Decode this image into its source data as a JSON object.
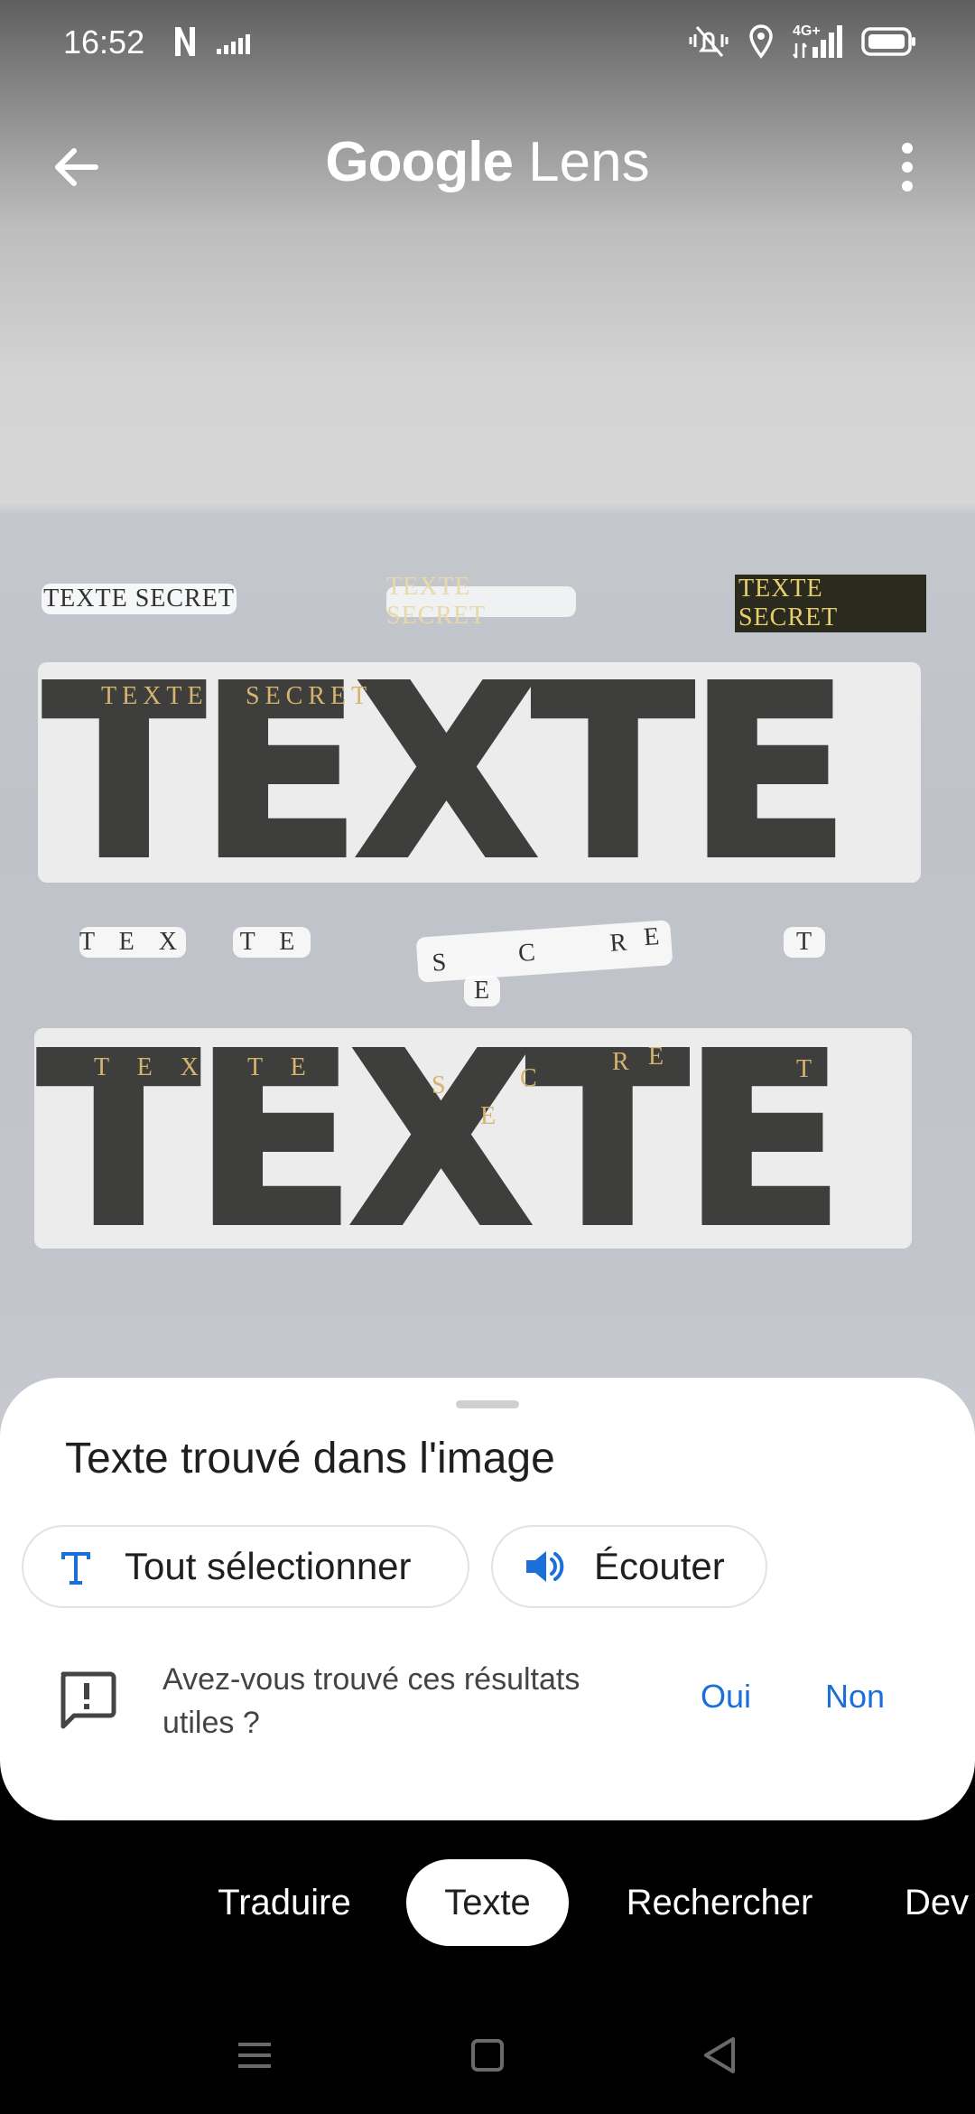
{
  "status_bar": {
    "time": "16:52",
    "icons_left": [
      "netflix-icon",
      "signal-bars-icon"
    ],
    "icons_right": [
      "vibrate-off-icon",
      "location-icon",
      "4g-signal-icon",
      "battery-icon"
    ],
    "network": "4G+"
  },
  "header": {
    "back_icon": "arrow-left-icon",
    "title_brand": "Google",
    "title_product": "Lens",
    "more_icon": "more-vert-icon"
  },
  "image": {
    "small_labels": [
      "TEXTE SECRET",
      "TEXTE SECRET",
      "TEXTE SECRET"
    ],
    "big_word_1": "TEXTE",
    "big_word_2": "TEXTE",
    "overlay_1": [
      "TEXTE",
      "SECRET"
    ],
    "split_labels": [
      "T E X",
      "T E",
      "S",
      "C",
      "R",
      "E",
      "E",
      "T"
    ],
    "overlay_2": [
      "T E X",
      "T E",
      "S",
      "C",
      "E",
      "R",
      "E",
      "T"
    ]
  },
  "sheet": {
    "title": "Texte trouvé dans l'image",
    "select_all_label": "Tout sélectionner",
    "listen_label": "Écouter",
    "feedback_question": "Avez-vous trouvé ces résultats utiles ?",
    "yes_label": "Oui",
    "no_label": "Non",
    "accent": "#1a6fd8"
  },
  "modes": {
    "tabs": [
      "Traduire",
      "Texte",
      "Rechercher",
      "Dev"
    ],
    "active": "Texte"
  },
  "nav_bar": {
    "icons": [
      "menu-icon",
      "home-square-icon",
      "back-triangle-icon"
    ]
  }
}
